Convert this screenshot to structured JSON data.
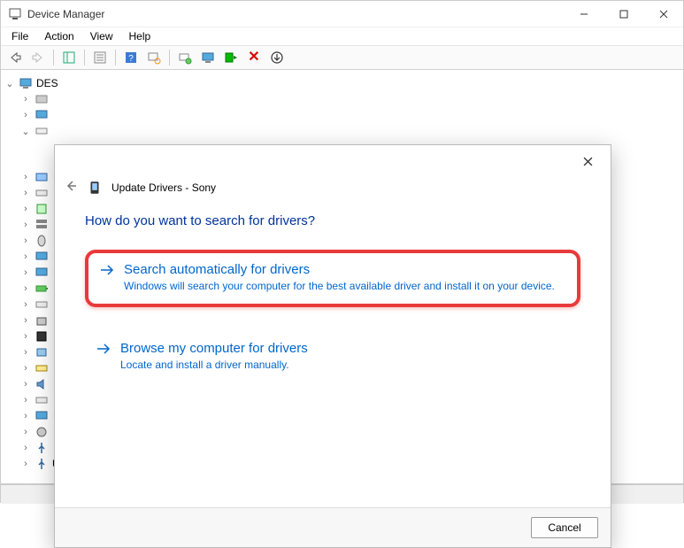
{
  "window": {
    "title": "Device Manager"
  },
  "menubar": {
    "items": [
      "File",
      "Action",
      "View",
      "Help"
    ]
  },
  "toolbar": {
    "icons": [
      "back-icon",
      "forward-icon",
      "show-hide-tree-icon",
      "properties-icon",
      "help-icon",
      "scan-hardware-icon",
      "update-driver-icon",
      "device-icon-tool",
      "enable-icon",
      "disable-icon",
      "uninstall-icon"
    ]
  },
  "tree": {
    "root": {
      "label": "DES",
      "icon": "computer-icon"
    },
    "visible_last_node": {
      "label": "Universal Serial Bus controllers"
    }
  },
  "dialog": {
    "nav_title": "Update Drivers - Sony",
    "heading": "How do you want to search for drivers?",
    "option1": {
      "title": "Search automatically for drivers",
      "desc": "Windows will search your computer for the best available driver and install it on your device."
    },
    "option2": {
      "title": "Browse my computer for drivers",
      "desc": "Locate and install a driver manually."
    },
    "cancel": "Cancel"
  }
}
